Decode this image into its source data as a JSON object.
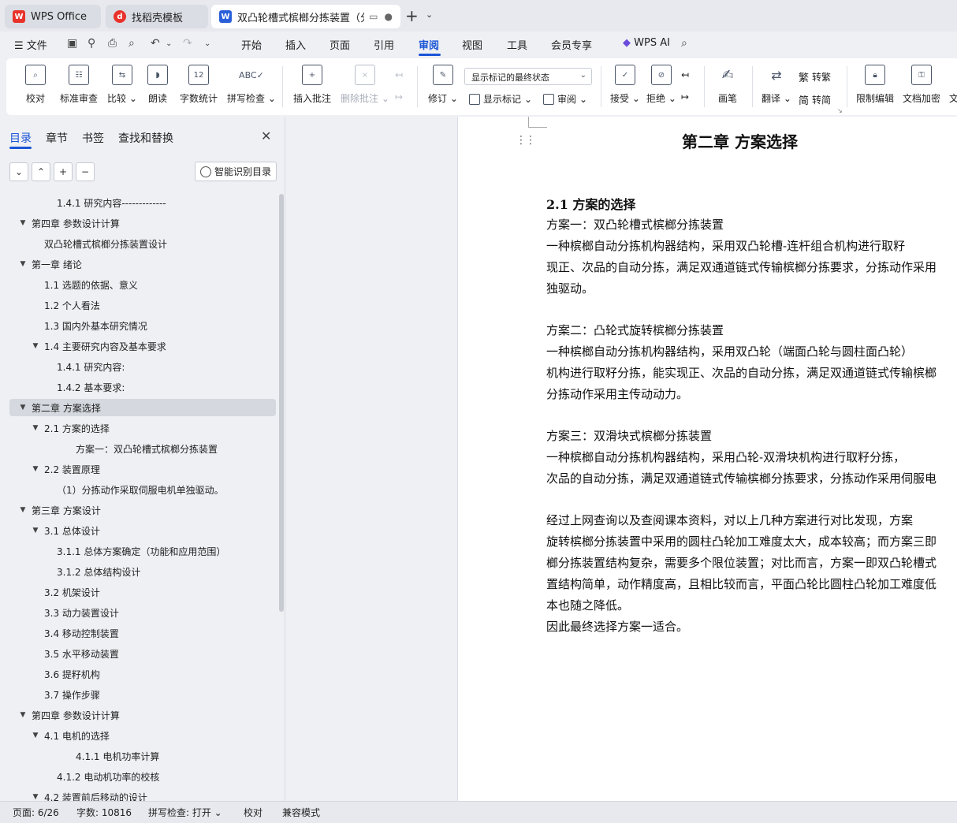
{
  "tabs": [
    {
      "label": "WPS Office",
      "icon": "wps-logo-icon",
      "color": "#e8322b"
    },
    {
      "label": "找稻壳模板",
      "icon": "docer-logo-icon",
      "color": "#e8322b"
    },
    {
      "label": "双凸轮槽式槟榔分拣装置（分",
      "icon": "word-doc-icon",
      "color": "#2b5fd9"
    }
  ],
  "menu": {
    "file": "文件",
    "items": [
      "开始",
      "插入",
      "页面",
      "引用",
      "审阅",
      "视图",
      "工具",
      "会员专享"
    ],
    "active": "审阅",
    "wps_ai": "WPS AI"
  },
  "ribbon": {
    "proofread": "校对",
    "standard_review": "标准审查",
    "compare": "比较",
    "read_aloud": "朗读",
    "word_count": "字数统计",
    "spell_check": "拼写检查",
    "insert_comment": "插入批注",
    "delete_comment": "删除批注",
    "track_changes": "修订",
    "markup_select": "显示标记的最终状态",
    "show_markup": "显示标记",
    "review": "审阅",
    "accept": "接受",
    "reject": "拒绝",
    "pen": "画笔",
    "translate": "翻译",
    "to_traditional": "转繁",
    "to_simplified": "转简",
    "restrict_edit": "限制编辑",
    "doc_encrypt": "文档加密",
    "more": "文"
  },
  "nav": {
    "tabs": [
      "目录",
      "章节",
      "书签",
      "查找和替换"
    ],
    "active_tab": "目录",
    "smart_toc": "智能识别目录",
    "toc": [
      {
        "text": "1.4.1  研究内容-------------",
        "level": 2,
        "arrow": ""
      },
      {
        "text": "第四章    参数设计计算",
        "level": 0,
        "arrow": "▼"
      },
      {
        "text": "双凸轮槽式槟榔分拣装置设计",
        "level": 1,
        "arrow": ""
      },
      {
        "text": "第一章  绪论",
        "level": 0,
        "arrow": "▼"
      },
      {
        "text": "1.1 选题的依据、意义",
        "level": 1,
        "arrow": ""
      },
      {
        "text": "1.2    个人看法",
        "level": 1,
        "arrow": ""
      },
      {
        "text": "1.3    国内外基本研究情况",
        "level": 1,
        "arrow": ""
      },
      {
        "text": "1.4    主要研究内容及基本要求",
        "level": 1,
        "arrow": "▼"
      },
      {
        "text": "1.4.1     研究内容:",
        "level": 2,
        "arrow": ""
      },
      {
        "text": "1.4.2     基本要求:",
        "level": 2,
        "arrow": ""
      },
      {
        "text": "第二章  方案选择",
        "level": 0,
        "arrow": "▼",
        "selected": true
      },
      {
        "text": "2.1  方案的选择",
        "level": 1,
        "arrow": "▼"
      },
      {
        "text": "方案一：双凸轮槽式槟榔分拣装置",
        "level": 3,
        "arrow": ""
      },
      {
        "text": "2.2  装置原理",
        "level": 1,
        "arrow": "▼"
      },
      {
        "text": "（1）分拣动作采取伺服电机单独驱动。",
        "level": 2,
        "arrow": ""
      },
      {
        "text": "第三章    方案设计",
        "level": 0,
        "arrow": "▼"
      },
      {
        "text": "3.1    总体设计",
        "level": 1,
        "arrow": "▼"
      },
      {
        "text": "3.1.1  总体方案确定（功能和应用范围）",
        "level": 2,
        "arrow": ""
      },
      {
        "text": "3.1.2  总体结构设计",
        "level": 2,
        "arrow": ""
      },
      {
        "text": "3.2    机架设计",
        "level": 1,
        "arrow": ""
      },
      {
        "text": "3.3    动力装置设计",
        "level": 1,
        "arrow": ""
      },
      {
        "text": "3.4    移动控制装置",
        "level": 1,
        "arrow": ""
      },
      {
        "text": "3.5    水平移动装置",
        "level": 1,
        "arrow": ""
      },
      {
        "text": "3.6    提籽机构",
        "level": 1,
        "arrow": ""
      },
      {
        "text": "3.7    操作步骤",
        "level": 1,
        "arrow": ""
      },
      {
        "text": "第四章  参数设计计算",
        "level": 0,
        "arrow": "▼"
      },
      {
        "text": "4.1  电机的选择",
        "level": 1,
        "arrow": "▼"
      },
      {
        "text": "4.1.1  电机功率计算",
        "level": 3,
        "arrow": ""
      },
      {
        "text": "4.1.2  电动机功率的校核",
        "level": 2,
        "arrow": ""
      },
      {
        "text": "4.2    装置前后移动的设计",
        "level": 1,
        "arrow": "▼"
      }
    ]
  },
  "document": {
    "chapter_title": "第二章  方案选择",
    "section_title": "2.1 方案的选择",
    "paragraphs": [
      {
        "lines": [
          "    方案一：双凸轮槽式槟榔分拣装置"
        ]
      },
      {
        "lines": [
          "      一种槟榔自动分拣机构器结构，采用双凸轮槽-连杆组合机构进行取籽",
          "现正、次品的自动分拣，满足双通道链式传输槟榔分拣要求，分拣动作采用",
          "独驱动。"
        ]
      },
      {
        "lines": [
          "    方案二：凸轮式旋转槟榔分拣装置"
        ]
      },
      {
        "lines": [
          "      一种槟榔自动分拣机构器结构，采用双凸轮（端面凸轮与圆柱面凸轮）",
          "机构进行取籽分拣，能实现正、次品的自动分拣，满足双通道链式传输槟榔",
          "分拣动作采用主传动动力。"
        ]
      },
      {
        "lines": [
          "    方案三：双滑块式槟榔分拣装置"
        ]
      },
      {
        "lines": [
          "     一种槟榔自动分拣机构器结构，采用凸轮-双滑块机构进行取籽分拣，",
          "次品的自动分拣，满足双通道链式传输槟榔分拣要求，分拣动作采用伺服电"
        ]
      },
      {
        "lines": [
          "     经过上网查询以及查阅课本资料，对以上几种方案进行对比发现，方案",
          "旋转槟榔分拣装置中采用的圆柱凸轮加工难度太大，成本较高；而方案三即",
          "榔分拣装置结构复杂，需要多个限位装置；对比而言，方案一即双凸轮槽式",
          "置结构简单，动作精度高，且相比较而言，平面凸轮比圆柱凸轮加工难度低",
          "本也随之降低。",
          "     因此最终选择方案一适合。"
        ]
      }
    ]
  },
  "status": {
    "page": "页面: 6/26",
    "words": "字数: 10816",
    "spell": "拼写检查: 打开",
    "proof": "校对",
    "compat": "兼容模式"
  },
  "colors": {
    "accent": "#1a55d6",
    "wps_red": "#e8322b"
  }
}
